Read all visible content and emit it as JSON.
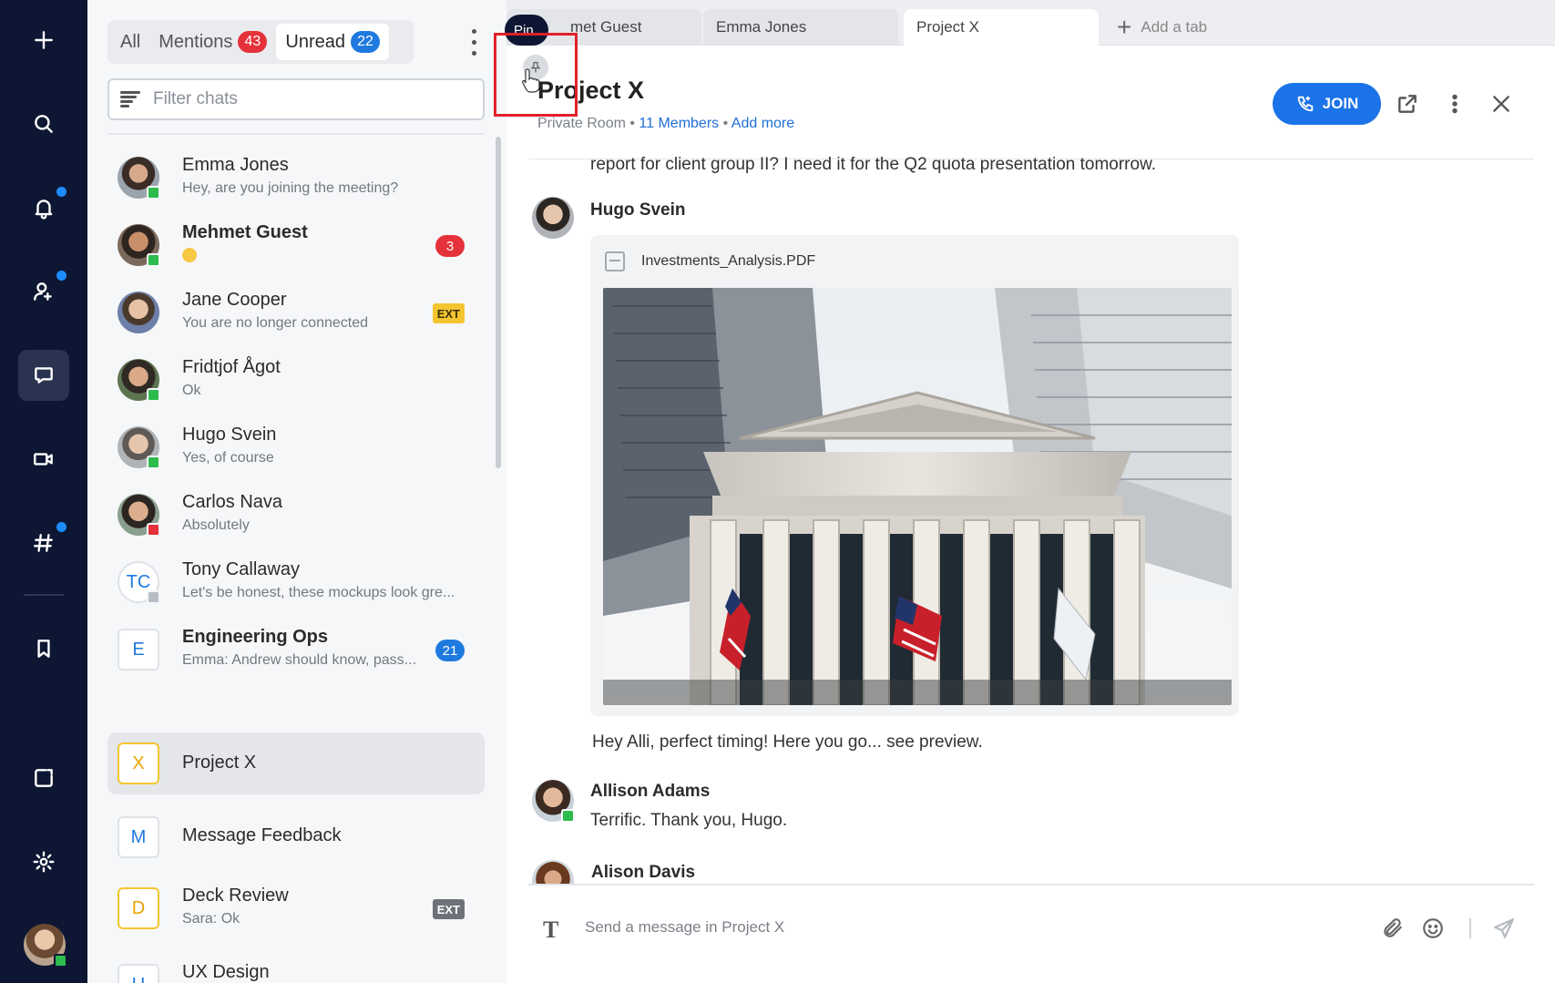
{
  "sidebar_tabs": {
    "all": "All",
    "mentions": "Mentions",
    "mentions_count": "43",
    "unread": "Unread",
    "unread_count": "22"
  },
  "filter": {
    "placeholder": "Filter chats"
  },
  "chats": [
    {
      "name": "Emma Jones",
      "preview": "Hey, are you joining the meeting?"
    },
    {
      "name": "Mehmet Guest",
      "preview": "",
      "badge": "3"
    },
    {
      "name": "Jane Cooper",
      "preview": "You are no longer connected",
      "tag": "EXT"
    },
    {
      "name": "Fridtjof Ågot",
      "preview": "Ok"
    },
    {
      "name": "Hugo Svein",
      "preview": "Yes, of course"
    },
    {
      "name": "Carlos Nava",
      "preview": "Absolutely"
    },
    {
      "name": "Tony Callaway",
      "initials": "TC",
      "preview": "Let's be honest, these mockups look gre..."
    },
    {
      "name": "Engineering Ops",
      "initials": "E",
      "preview": "Emma: Andrew should know, pass...",
      "badge": "21"
    },
    {
      "name": "Project X",
      "initials": "X"
    },
    {
      "name": "Message Feedback",
      "initials": "M"
    },
    {
      "name": "Deck Review",
      "initials": "D",
      "preview": "Sara: Ok",
      "tag": "EXT"
    },
    {
      "name": "UX Design",
      "initials": "U"
    }
  ],
  "tabs": {
    "pin_pill": "Pin",
    "tab1": "met Guest",
    "tab2": "Emma Jones",
    "tab3": "Project X",
    "add": "Add a tab"
  },
  "room": {
    "title": "Project X",
    "type": "Private Room",
    "members": "11 Members",
    "add_more": "Add more",
    "join": "JOIN"
  },
  "messages": {
    "cut_text": "report for client group II? I need it for the Q2 quota presentation tomorrow.",
    "m1_author": "Hugo Svein",
    "m1_file": "Investments_Analysis.PDF",
    "m1_text": "Hey Alli, perfect timing! Here you go... see preview.",
    "m2_author": "Allison Adams",
    "m2_text": "Terrific. Thank you, Hugo.",
    "m3_author": "Alison Davis"
  },
  "composer": {
    "placeholder": "Send a message in Project X"
  },
  "colors": {
    "rail": "#0d1733",
    "accent_blue": "#1a73e8",
    "badge_red": "#e5323a",
    "online": "#2dbb4e"
  }
}
